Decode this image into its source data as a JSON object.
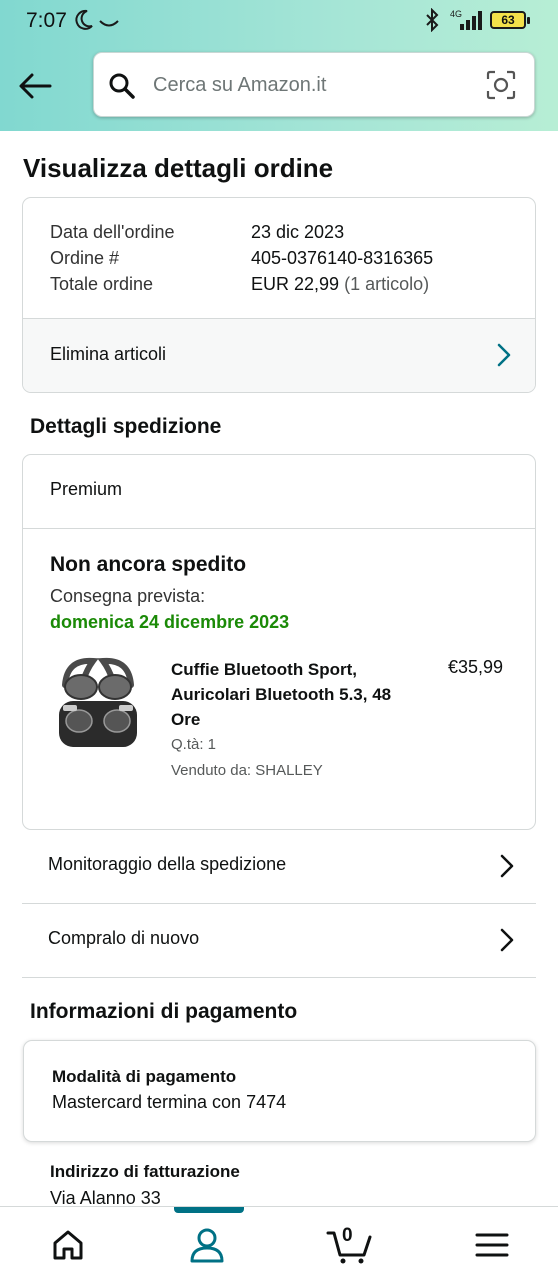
{
  "status_bar": {
    "time": "7:07",
    "network": "4G",
    "battery": "63"
  },
  "search": {
    "placeholder": "Cerca su Amazon.it"
  },
  "page_title": "Visualizza dettagli ordine",
  "order_summary": {
    "rows": [
      {
        "label": "Data dell'ordine",
        "value": "23 dic 2023"
      },
      {
        "label": "Ordine #",
        "value": "405-0376140-8316365"
      },
      {
        "label": "Totale ordine",
        "value": "EUR 22,99",
        "extra": "(1 articolo)"
      }
    ],
    "delete_items_label": "Elimina articoli"
  },
  "shipping": {
    "section_title": "Dettagli spedizione",
    "method": "Premium",
    "status": "Non ancora spedito",
    "expected_label": "Consegna prevista:",
    "expected_date": "domenica 24 dicembre 2023",
    "item": {
      "name": "Cuffie Bluetooth Sport, Auricolari Bluetooth 5.3, 48 Ore",
      "price": "€35,99",
      "quantity": "Q.tà: 1",
      "seller": "Venduto da: SHALLEY"
    }
  },
  "actions": {
    "track_label": "Monitoraggio della spedizione",
    "buy_again_label": "Compralo di nuovo"
  },
  "payment": {
    "section_title": "Informazioni di pagamento",
    "method_label": "Modalità di pagamento",
    "method_value": "Mastercard  termina con 7474",
    "billing_label": "Indirizzo di fatturazione",
    "billing_value": "Via Alanno 33"
  },
  "bottom_nav": {
    "items": [
      "home-icon",
      "account-icon",
      "cart-icon",
      "menu-icon"
    ],
    "cart_count": "0",
    "active_color": "#007185"
  },
  "colors": {
    "accent": "#007185",
    "delivery_green": "#1b8a07",
    "header_gradient": [
      "#81d8d0",
      "#b7eed5"
    ]
  }
}
